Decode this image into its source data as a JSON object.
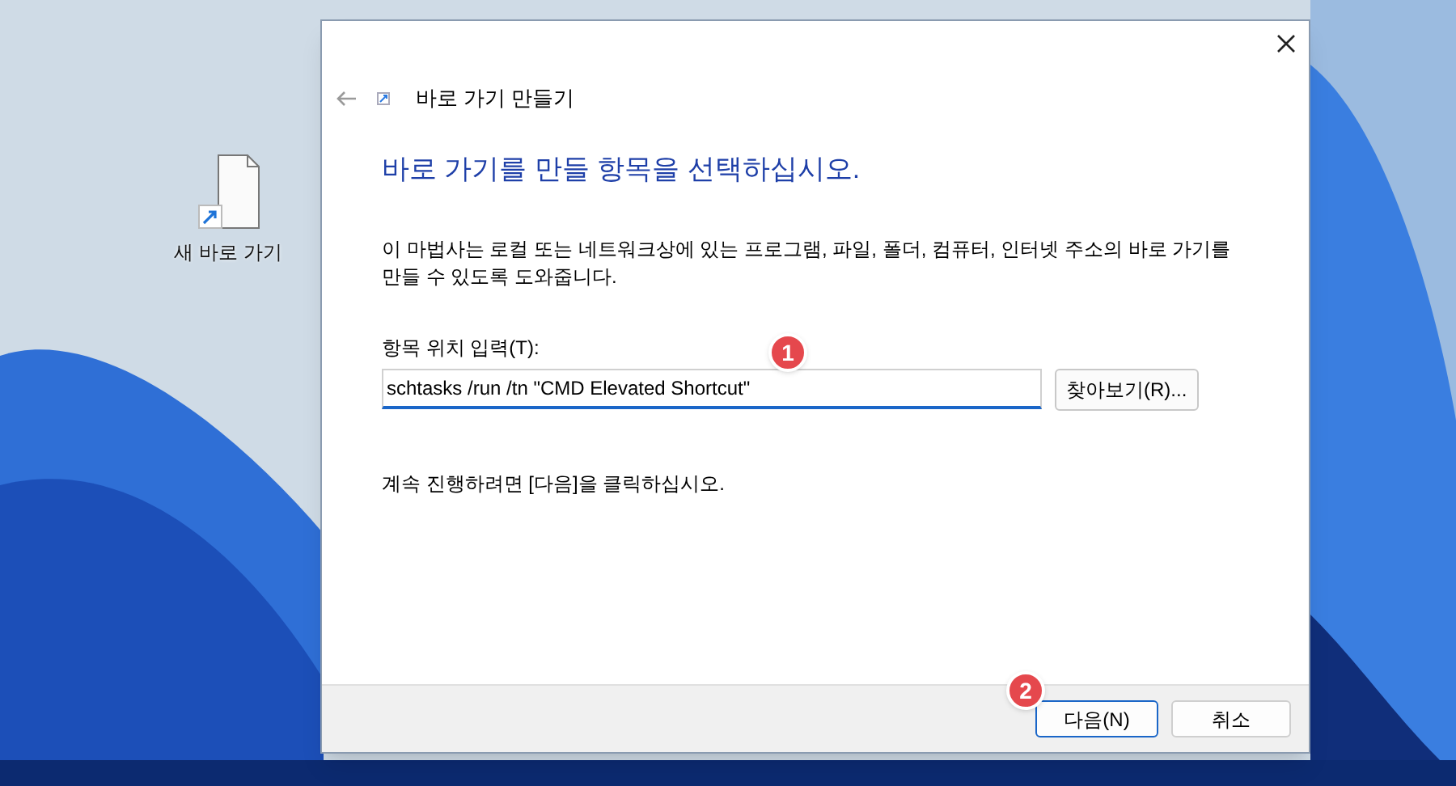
{
  "desktop": {
    "icons": [
      {
        "label": "새 바로 가기"
      }
    ]
  },
  "dialog": {
    "title": "바로 가기 만들기",
    "heading": "바로 가기를 만들 항목을 선택하십시오.",
    "description": "이 마법사는 로컬 또는 네트워크상에 있는 프로그램, 파일, 폴더, 컴퓨터, 인터넷 주소의 바로 가기를 만들 수 있도록 도와줍니다.",
    "field": {
      "label": "항목 위치 입력(T):",
      "value": "schtasks /run /tn \"CMD Elevated Shortcut\""
    },
    "browse_button": "찾아보기(R)...",
    "hint": "계속 진행하려면 [다음]을 클릭하십시오.",
    "buttons": [
      {
        "label": "다음(N)",
        "selected": true
      },
      {
        "label": "취소",
        "selected": false
      }
    ]
  },
  "annotations": [
    {
      "label": "1"
    },
    {
      "label": "2"
    }
  ]
}
